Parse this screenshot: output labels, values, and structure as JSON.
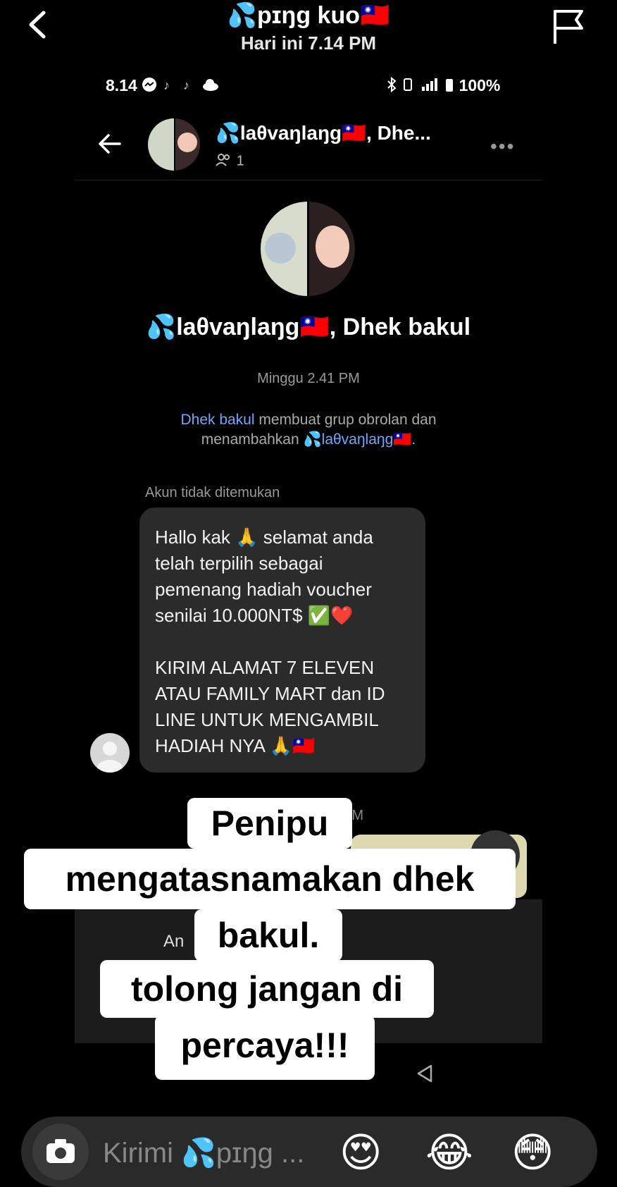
{
  "outer_header": {
    "title": "💦pɪŋg kuo🇹🇼",
    "subtitle": "Hari ini 7.14 PM"
  },
  "status_bar": {
    "time": "8.14",
    "battery": "100%"
  },
  "chat_header": {
    "title": "💦laθvaŋlaŋg🇹🇼, Dhe...",
    "members": "1"
  },
  "group": {
    "name": "💦laθvaŋlaŋg🇹🇼, Dhek bakul"
  },
  "messages": {
    "date1": "Minggu 2.41 PM",
    "system_actor": "Dhek bakul",
    "system_text_1": " membuat grup obrolan dan",
    "system_text_2": "menambahkan ",
    "system_added": "💦laθvaŋlaŋg🇹🇼",
    "system_end": ".",
    "unknown_sender": "Akun tidak ditemukan",
    "bubble_text": "Hallo kak 🙏 selamat anda\ntelah terpilih sebagai\npemenang hadiah voucher\nsenilai 10.000NT$ ✅❤️\n\nKIRIM ALAMAT 7 ELEVEN\nATAU FAMILY MART dan ID\nLINE UNTUK MENGAMBIL\nHADIAH NYA 🙏🇹🇼",
    "date2_fragment": "PM",
    "banner_fragment": "An          dari grup ini."
  },
  "caption": {
    "line1": "Penipu",
    "line2": "mengatasnamakan dhek",
    "line3": "bakul.",
    "line4": "tolong jangan di",
    "line5": "percaya!!!"
  },
  "input_bar": {
    "placeholder": "Kirimi 💦pɪŋg ...",
    "emoji1": "😍",
    "emoji2": "😂",
    "emoji3": "😳"
  },
  "icons": [
    "back-chevron-icon",
    "flag-icon",
    "camera-icon",
    "more-icon",
    "members-icon",
    "nav-back-icon"
  ]
}
